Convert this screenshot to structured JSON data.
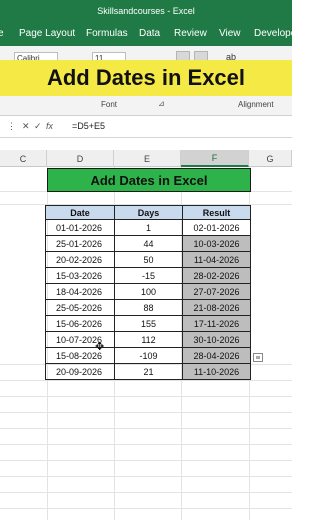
{
  "window": {
    "title": "Skillsandcourses - Excel"
  },
  "ribbon_tabs": [
    "e",
    "Page Layout",
    "Formulas",
    "Data",
    "Review",
    "View",
    "Develope"
  ],
  "ribbon": {
    "font_name": "Calibri",
    "font_size": "11",
    "group_font": "Font",
    "group_alignment": "Alignment"
  },
  "banner": {
    "text": "Add Dates in Excel"
  },
  "formula_bar": {
    "cancel": "✕",
    "confirm": "✓",
    "fx": "fx",
    "formula": "=D5+E5"
  },
  "columns": [
    "C",
    "D",
    "E",
    "F",
    "G"
  ],
  "sheet": {
    "title": "Add Dates in Excel",
    "headers": [
      "Date",
      "Days",
      "Result"
    ],
    "rows": [
      [
        "01-01-2026",
        "1",
        "02-01-2026"
      ],
      [
        "25-01-2026",
        "44",
        "10-03-2026"
      ],
      [
        "20-02-2026",
        "50",
        "11-04-2026"
      ],
      [
        "15-03-2026",
        "-15",
        "28-02-2026"
      ],
      [
        "18-04-2026",
        "100",
        "27-07-2026"
      ],
      [
        "25-05-2026",
        "88",
        "21-08-2026"
      ],
      [
        "15-06-2026",
        "155",
        "17-11-2026"
      ],
      [
        "10-07-2026",
        "112",
        "30-10-2026"
      ],
      [
        "15-08-2026",
        "-109",
        "28-04-2026"
      ],
      [
        "20-09-2026",
        "21",
        "11-10-2026"
      ]
    ]
  },
  "colors": {
    "excel_green": "#1f7a46",
    "banner_yellow": "#f5ea45",
    "title_green": "#2eb34a",
    "header_blue": "#c9d9ee",
    "selected_gray": "#bdbdbd"
  }
}
